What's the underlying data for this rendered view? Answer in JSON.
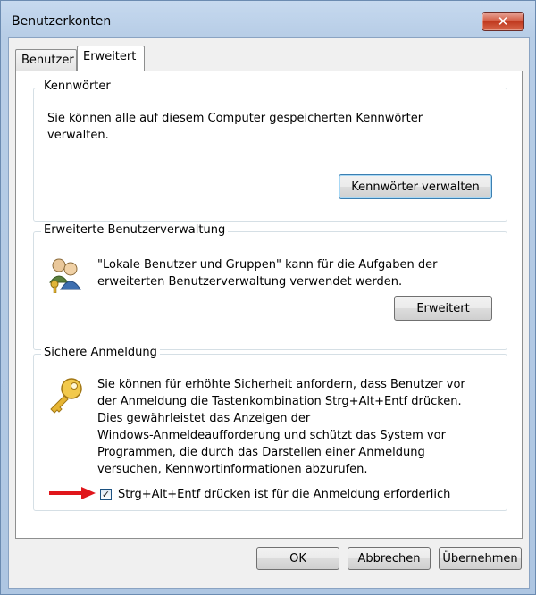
{
  "window": {
    "title": "Benutzerkonten",
    "close_label": "✕"
  },
  "tabs": [
    {
      "label": "Benutzer",
      "selected": false
    },
    {
      "label": "Erweitert",
      "selected": true
    }
  ],
  "passwords_group": {
    "title": "Kennwörter",
    "line1": "Sie können alle auf diesem Computer gespeicherten Kennwörter",
    "line2": "verwalten.",
    "button": "Kennwörter verwalten"
  },
  "advanced_user_group": {
    "title": "Erweiterte Benutzerverwaltung",
    "line1": "\"Lokale Benutzer und Gruppen\" kann für die Aufgaben der",
    "line2": "erweiterten Benutzerverwaltung verwendet werden.",
    "button": "Erweitert",
    "icon": "users-key-icon"
  },
  "secure_logon_group": {
    "title": "Sichere Anmeldung",
    "lines": [
      "Sie können für erhöhte Sicherheit anfordern, dass Benutzer vor",
      "der Anmeldung die Tastenkombination Strg+Alt+Entf drücken.",
      "Dies gewährleistet das Anzeigen der",
      "Windows-Anmeldeaufforderung und schützt das System vor",
      "Programmen, die durch das Darstellen einer Anmeldung",
      "versuchen, Kennwortinformationen abzurufen."
    ],
    "checkbox_label": "Strg+Alt+Entf drücken ist für die Anmeldung erforderlich",
    "checkbox_checked": true,
    "icon": "key-icon",
    "arrow_color": "#e0161b"
  },
  "footer": {
    "ok": "OK",
    "cancel": "Abbrechen",
    "apply": "Übernehmen"
  }
}
